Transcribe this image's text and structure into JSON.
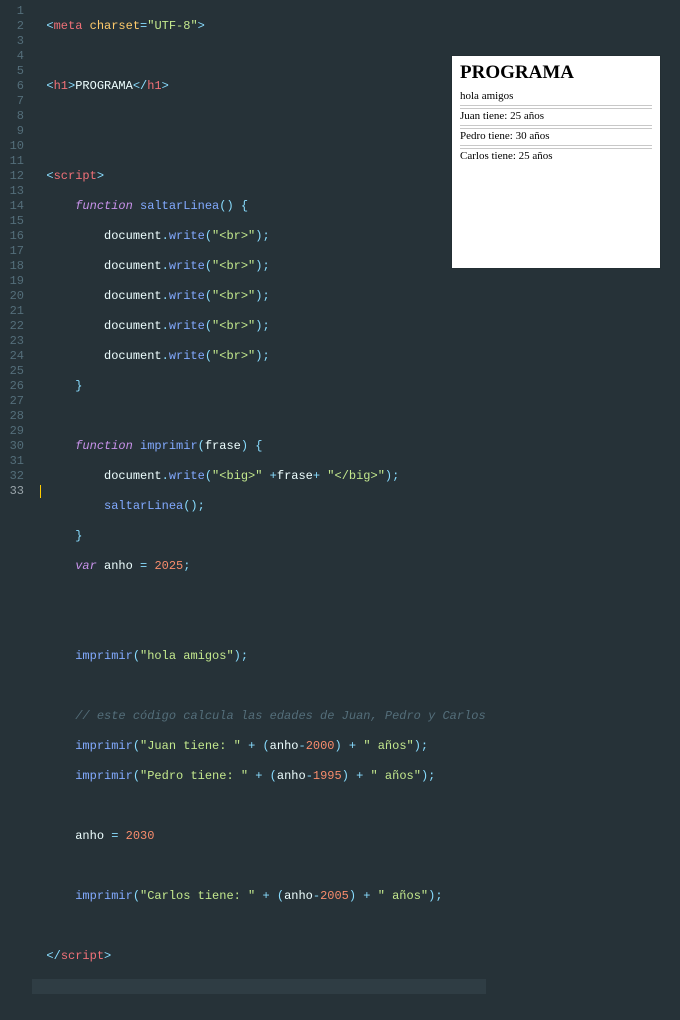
{
  "editor": {
    "gutter": [
      "1",
      "2",
      "3",
      "4",
      "5",
      "6",
      "7",
      "8",
      "9",
      "10",
      "11",
      "12",
      "13",
      "14",
      "15",
      "16",
      "17",
      "18",
      "19",
      "20",
      "21",
      "22",
      "23",
      "24",
      "25",
      "26",
      "27",
      "28",
      "29",
      "30",
      "31",
      "32",
      "33"
    ],
    "active_line": 33,
    "tokens": {
      "meta_tag": "meta",
      "charset_attr": "charset",
      "charset_val": "\"UTF-8\"",
      "h1_tag": "h1",
      "h1_text": "PROGRAMA",
      "script_tag": "script",
      "function_kw": "function",
      "saltarLinea_name": "saltarLinea",
      "imprimir_name": "imprimir",
      "frase_param": "frase",
      "document_obj": "document",
      "write_method": "write",
      "br_str": "\"<br>\"",
      "big_open": "\"<big>\"",
      "big_close": "\"</big>\"",
      "var_kw": "var",
      "anho_var": "anho",
      "num_2025": "2025",
      "num_2030": "2030",
      "num_2000": "2000",
      "num_1995": "1995",
      "num_2005": "2005",
      "str_hola": "\"hola amigos\"",
      "str_juan": "\"Juan tiene: \"",
      "str_pedro": "\"Pedro tiene: \"",
      "str_carlos": "\"Carlos tiene: \"",
      "str_anos": "\" años\"",
      "comment_line": "// este código calcula las edades de Juan, Pedro y Carlos"
    }
  },
  "preview": {
    "title": "PROGRAMA",
    "line1": "hola amigos",
    "line2": "Juan tiene: 25 años",
    "line3": "Pedro tiene: 30 años",
    "line4": "Carlos tiene: 25 años"
  }
}
